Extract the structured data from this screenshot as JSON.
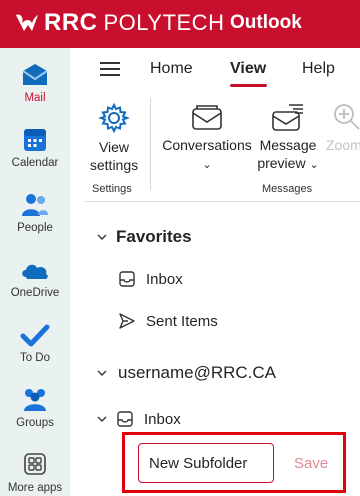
{
  "brand": {
    "name_bold": "RRC",
    "name_light": "POLYTECH",
    "app_title": "Outlook",
    "accent": "#c8102e"
  },
  "rail": [
    {
      "label": "Mail",
      "icon": "mail-icon",
      "active": true
    },
    {
      "label": "Calendar",
      "icon": "calendar-icon"
    },
    {
      "label": "People",
      "icon": "people-icon"
    },
    {
      "label": "OneDrive",
      "icon": "onedrive-icon"
    },
    {
      "label": "To Do",
      "icon": "todo-check-icon"
    },
    {
      "label": "Groups",
      "icon": "groups-icon"
    },
    {
      "label": "More apps",
      "icon": "more-apps-icon"
    }
  ],
  "tabs": {
    "home": "Home",
    "view": "View",
    "help": "Help",
    "active": "View"
  },
  "ribbon": {
    "view_settings_line1": "View",
    "view_settings_line2": "settings",
    "conversations": "Conversations",
    "message_preview_line1": "Message",
    "message_preview_line2": "preview",
    "zoom": "Zoom",
    "group_settings": "Settings",
    "group_messages": "Messages"
  },
  "folders": {
    "favorites": "Favorites",
    "fav_inbox": "Inbox",
    "fav_sent": "Sent Items",
    "account": "username@RRC.CA",
    "inbox": "Inbox"
  },
  "new_folder": {
    "value": "New Subfolder",
    "save_label": "Save"
  }
}
